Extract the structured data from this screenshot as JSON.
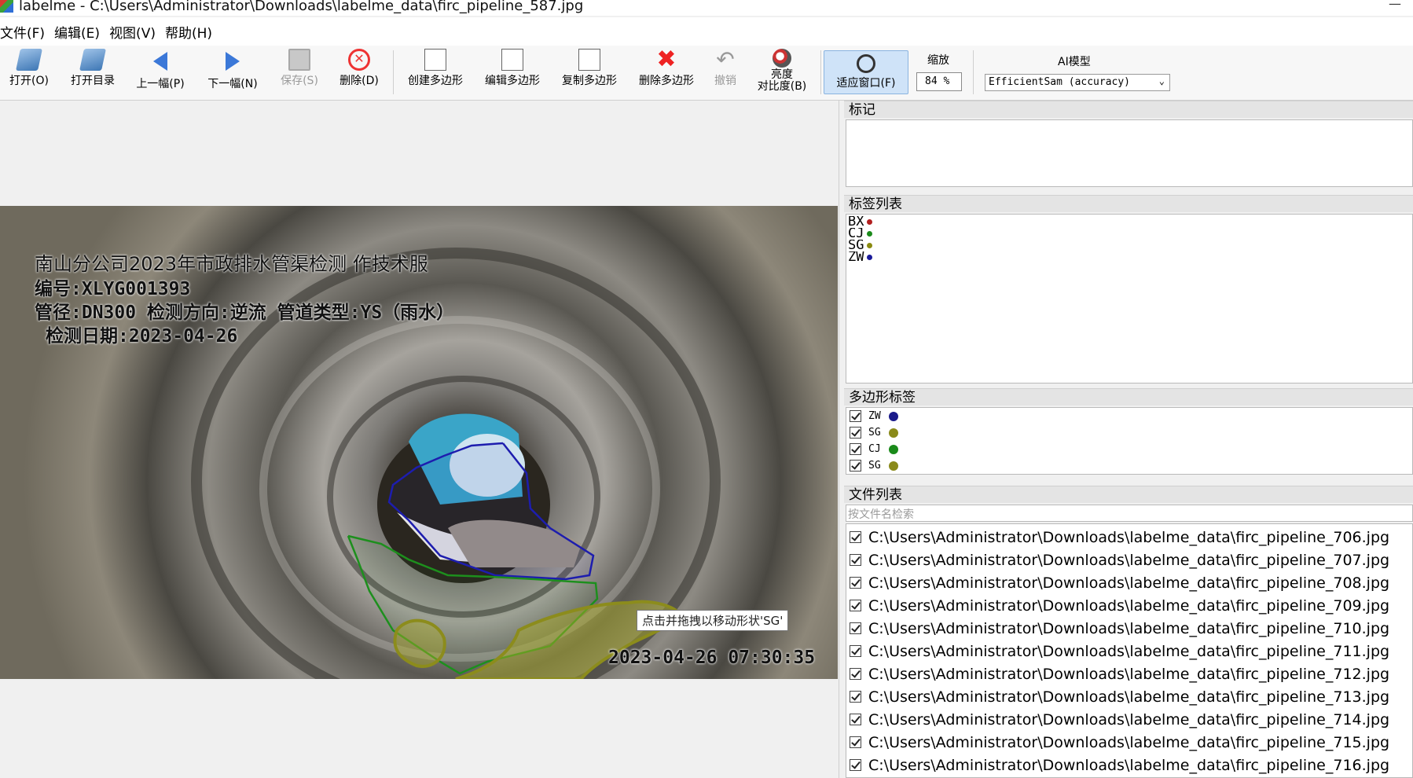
{
  "window": {
    "title": "labelme - C:\\Users\\Administrator\\Downloads\\labelme_data\\firc_pipeline_587.jpg",
    "minimize": "—"
  },
  "menu": [
    "文件(F)",
    "编辑(E)",
    "视图(V)",
    "帮助(H)"
  ],
  "toolbar": {
    "open": "打开(O)",
    "open_dir": "打开目录",
    "prev": "上一幅(P)",
    "next": "下一幅(N)",
    "save": "保存(S)",
    "delete": "删除(D)",
    "create_polygon": "创建多边形",
    "edit_polygon": "编辑多边形",
    "copy_polygon": "复制多边形",
    "delete_polygon": "删除多边形",
    "undo": "撤销",
    "brightness_line1": "亮度",
    "brightness_line2": "对比度(B)",
    "fit_window": "适应窗口(F)",
    "zoom_label": "缩放",
    "zoom_value": "84 %",
    "ai_label": "AI模型",
    "ai_model": "EfficientSam (accuracy)"
  },
  "image_overlay": {
    "line1": "南山分公司2023年市政排水管渠检测 作技术服",
    "line2": "编号:XLYG001393",
    "line3": "管径:DN300 检测方向:逆流 管道类型:YS（雨水）",
    "line4": "检测日期:2023-04-26",
    "timestamp": "2023-04-26 07:30:35"
  },
  "tooltip": "点击并拖拽以移动形状'SG'",
  "panels": {
    "flags_title": "标记",
    "labels_title": "标签列表",
    "labels": [
      {
        "name": "BX",
        "color": "#b21f1f"
      },
      {
        "name": "CJ",
        "color": "#1a8a1a"
      },
      {
        "name": "SG",
        "color": "#8a8a10"
      },
      {
        "name": "ZW",
        "color": "#1a1a9a"
      }
    ],
    "polygons_title": "多边形标签",
    "polygons": [
      {
        "name": "ZW",
        "color": "#1a1a8a"
      },
      {
        "name": "SG",
        "color": "#8a8a1a"
      },
      {
        "name": "CJ",
        "color": "#1a8a1a"
      },
      {
        "name": "SG",
        "color": "#8a8a1a"
      }
    ],
    "files_title": "文件列表",
    "file_search_placeholder": "按文件名检索",
    "files": [
      "C:\\Users\\Administrator\\Downloads\\labelme_data\\firc_pipeline_706.jpg",
      "C:\\Users\\Administrator\\Downloads\\labelme_data\\firc_pipeline_707.jpg",
      "C:\\Users\\Administrator\\Downloads\\labelme_data\\firc_pipeline_708.jpg",
      "C:\\Users\\Administrator\\Downloads\\labelme_data\\firc_pipeline_709.jpg",
      "C:\\Users\\Administrator\\Downloads\\labelme_data\\firc_pipeline_710.jpg",
      "C:\\Users\\Administrator\\Downloads\\labelme_data\\firc_pipeline_711.jpg",
      "C:\\Users\\Administrator\\Downloads\\labelme_data\\firc_pipeline_712.jpg",
      "C:\\Users\\Administrator\\Downloads\\labelme_data\\firc_pipeline_713.jpg",
      "C:\\Users\\Administrator\\Downloads\\labelme_data\\firc_pipeline_714.jpg",
      "C:\\Users\\Administrator\\Downloads\\labelme_data\\firc_pipeline_715.jpg",
      "C:\\Users\\Administrator\\Downloads\\labelme_data\\firc_pipeline_716.jpg"
    ]
  }
}
